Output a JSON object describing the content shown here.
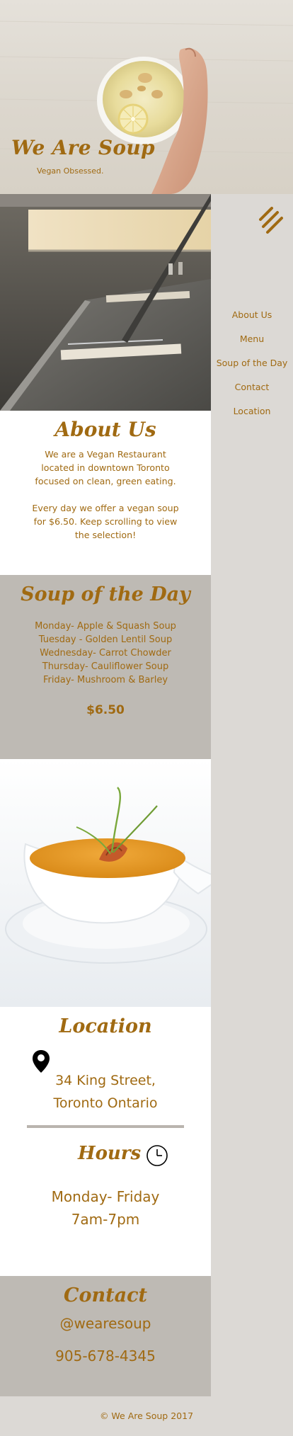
{
  "hero": {
    "title": "We Are Soup",
    "subtitle": "Vegan Obsessed."
  },
  "nav": {
    "items": [
      "About Us",
      "Menu",
      "Soup of the Day",
      "Contact",
      "Location"
    ],
    "menu_icon": "hamburger-icon"
  },
  "about": {
    "title": "About Us",
    "paragraph1": "We are a Vegan Restaurant located in downtown Toronto focused on clean, green eating.",
    "paragraph2": "Every day we offer a vegan soup for $6.50. Keep scrolling to view the selection!"
  },
  "soup_of_day": {
    "title": "Soup of the Day",
    "items": [
      "Monday- Apple & Squash Soup",
      "Tuesday - Golden Lentil Soup",
      "Wednesday- Carrot Chowder",
      "Thursday- Cauliflower Soup",
      "Friday- Mushroom & Barley"
    ],
    "price": "$6.50"
  },
  "location": {
    "title": "Location",
    "address_line1": "34 King Street,",
    "address_line2": "Toronto Ontario",
    "icon": "map-pin-icon"
  },
  "hours": {
    "title": "Hours",
    "days": "Monday- Friday",
    "time": "7am-7pm",
    "icon": "clock-icon"
  },
  "contact": {
    "title": "Contact",
    "handle": "@wearesoup",
    "phone": "905-678-4345"
  },
  "footer": {
    "text": "© We Are Soup 2017"
  },
  "colors": {
    "accent": "#a06a12",
    "sidebar_bg": "#dcd9d5",
    "band_bg": "#bebab4",
    "white": "#ffffff"
  }
}
